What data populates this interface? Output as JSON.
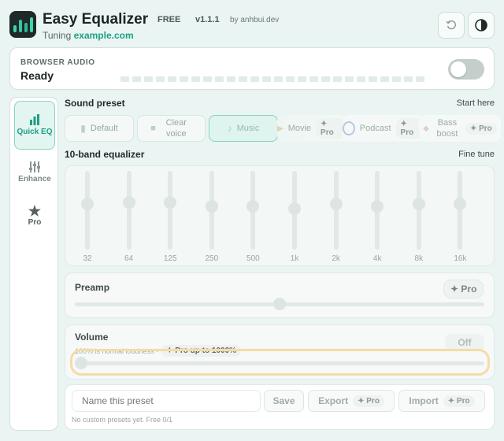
{
  "app": {
    "title": "Easy Equalizer",
    "plan": "FREE",
    "version": "v1.1.1",
    "author": "by anhbui.dev",
    "tuning_prefix": "Tuning",
    "tuning_site": "example.com"
  },
  "browser_audio": {
    "label": "BROWSER AUDIO",
    "status": "Ready",
    "enabled": false
  },
  "sidebar": [
    {
      "label": "Quick EQ",
      "icon": "bars-icon",
      "active": true
    },
    {
      "label": "Enhance",
      "icon": "sliders-icon",
      "active": false
    },
    {
      "label": "Pro",
      "icon": "star-icon",
      "active": false
    }
  ],
  "sound_preset": {
    "title": "Sound preset",
    "hint": "Start here",
    "presets": [
      {
        "label": "Default",
        "pro": ""
      },
      {
        "label": "Clear voice",
        "pro": ""
      },
      {
        "label": "Music",
        "pro": "",
        "selected": true
      },
      {
        "label": "Movie",
        "pro": "✦ Pro"
      },
      {
        "label": "Podcast",
        "pro": "✦ Pro"
      },
      {
        "label": "Bass boost",
        "pro": "✦ Pro"
      }
    ]
  },
  "equalizer": {
    "title": "10-band equalizer",
    "hint": "Fine tune",
    "bands": [
      {
        "freq": "32",
        "level": 0.42
      },
      {
        "freq": "64",
        "level": 0.4
      },
      {
        "freq": "125",
        "level": 0.4
      },
      {
        "freq": "250",
        "level": 0.45
      },
      {
        "freq": "500",
        "level": 0.45
      },
      {
        "freq": "1k",
        "level": 0.48
      },
      {
        "freq": "2k",
        "level": 0.42
      },
      {
        "freq": "4k",
        "level": 0.45
      },
      {
        "freq": "8k",
        "level": 0.42
      },
      {
        "freq": "16k",
        "level": 0.42
      }
    ]
  },
  "preamp": {
    "label": "Preamp",
    "pro": "✦ Pro",
    "level": 0.5
  },
  "volume": {
    "label": "Volume",
    "note": "100% is normal loudness ·",
    "pro": "✦ Pro up to 1000%",
    "toggle": "Off",
    "level": 0.0
  },
  "custom": {
    "placeholder": "Name this preset",
    "save": "Save",
    "export": "Export",
    "export_pro": "✦ Pro",
    "import": "Import",
    "import_pro": "✦ Pro",
    "footnote": "No custom presets yet. Free 0/1"
  },
  "colors": {
    "accent": "#1aa186",
    "highlight_ring": "#f4dba8"
  }
}
